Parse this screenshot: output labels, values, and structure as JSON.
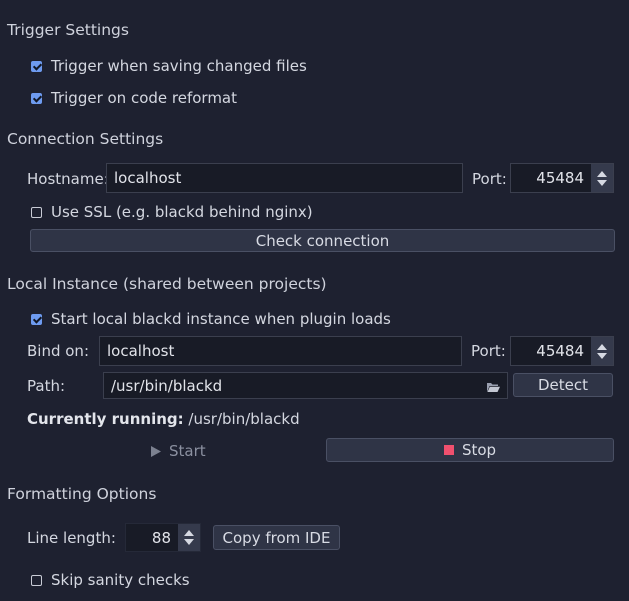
{
  "trigger": {
    "title": "Trigger Settings",
    "on_save_label": "Trigger when saving changed files",
    "on_save_checked": true,
    "on_reformat_label": "Trigger on code reformat",
    "on_reformat_checked": true
  },
  "connection": {
    "title": "Connection Settings",
    "hostname_label": "Hostname:",
    "hostname_value": "localhost",
    "port_label": "Port:",
    "port_value": "45484",
    "ssl_label": "Use SSL (e.g. blackd behind nginx)",
    "ssl_checked": false,
    "check_button": "Check connection"
  },
  "local": {
    "title": "Local Instance (shared between projects)",
    "start_local_label": "Start local blackd instance when plugin loads",
    "start_local_checked": true,
    "bind_label": "Bind on:",
    "bind_value": "localhost",
    "port_label": "Port:",
    "port_value": "45484",
    "path_label": "Path:",
    "path_value": "/usr/bin/blackd",
    "detect_button": "Detect",
    "running_label": "Currently running:",
    "running_value": "/usr/bin/blackd",
    "start_button": "Start",
    "stop_button": "Stop",
    "stop_color": "#f0506e"
  },
  "formatting": {
    "title": "Formatting Options",
    "line_length_label": "Line length:",
    "line_length_value": "88",
    "copy_button": "Copy from IDE",
    "sanity_label": "Skip sanity checks",
    "sanity_checked": false
  },
  "icons": [
    "folder-icon",
    "play-icon",
    "stop-icon",
    "spin-up-icon",
    "spin-down-icon",
    "checkbox-icon"
  ]
}
